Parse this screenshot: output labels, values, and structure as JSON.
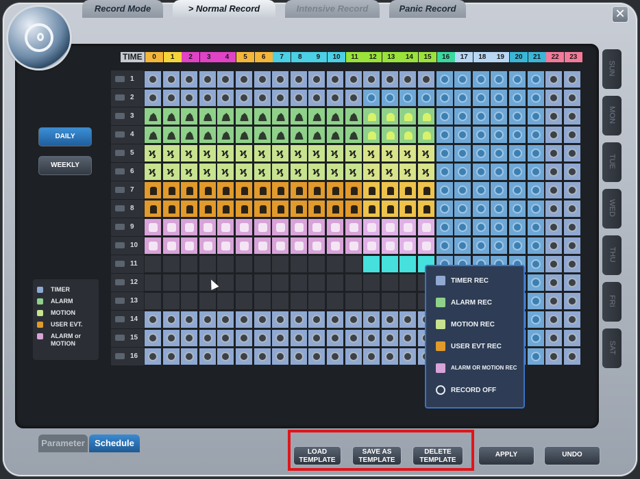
{
  "window": {
    "close_glyph": "✕"
  },
  "tabs": [
    {
      "label": "Record Mode",
      "state": "normal"
    },
    {
      "label": "Normal Record",
      "state": "active",
      "prefix": ">"
    },
    {
      "label": "Intensive Record",
      "state": "disabled"
    },
    {
      "label": "Panic Record",
      "state": "normal"
    }
  ],
  "schedule": {
    "time_label": "TIME",
    "hours": [
      "0",
      "1",
      "2",
      "3",
      "4",
      "5",
      "6",
      "7",
      "8",
      "9",
      "10",
      "11",
      "12",
      "13",
      "14",
      "15",
      "16",
      "17",
      "18",
      "19",
      "20",
      "21",
      "22",
      "23"
    ],
    "hour_colors": [
      "#f4b63a",
      "#f4d63a",
      "#e043c6",
      "#e043c6",
      "#e043c6",
      "#f4b63a",
      "#f4b63a",
      "#4bd0e6",
      "#4bd0e6",
      "#4bd0e6",
      "#4bd0e6",
      "#9ae33a",
      "#9ae33a",
      "#9ae33a",
      "#9ae33a",
      "#9ae33a",
      "#3ad8a0",
      "#b7d7f3",
      "#b7d7f3",
      "#b7d7f3",
      "#3ab7d8",
      "#3ab7d8",
      "#f47a9a",
      "#f47a9a"
    ],
    "channels": [
      "1",
      "2",
      "3",
      "4",
      "5",
      "6",
      "7",
      "8",
      "9",
      "10",
      "11",
      "12",
      "13",
      "14",
      "15",
      "16"
    ],
    "rows": [
      {
        "fill": "timer",
        "split": null
      },
      {
        "fill": "timer",
        "split": {
          "from": 12,
          "to": 15,
          "type": "timer2"
        }
      },
      {
        "fill": "alarm",
        "split": {
          "from": 12,
          "to": 15,
          "type": "alarm2"
        }
      },
      {
        "fill": "alarm",
        "split": {
          "from": 12,
          "to": 15,
          "type": "alarm2"
        }
      },
      {
        "fill": "motion",
        "split": {
          "from": 12,
          "to": 15,
          "type": "motion2"
        }
      },
      {
        "fill": "motion",
        "split": {
          "from": 12,
          "to": 15,
          "type": "motion2"
        }
      },
      {
        "fill": "user",
        "split": {
          "from": 12,
          "to": 15,
          "type": "user2"
        }
      },
      {
        "fill": "user",
        "split": {
          "from": 12,
          "to": 15,
          "type": "user2"
        }
      },
      {
        "fill": "alarmmot",
        "split": {
          "from": 12,
          "to": 15,
          "type": "alarmmot2"
        }
      },
      {
        "fill": "alarmmot",
        "split": {
          "from": 12,
          "to": 15,
          "type": "alarmmot2"
        }
      },
      {
        "fill": "off",
        "split": {
          "from": 12,
          "to": 15,
          "type": "cyan"
        }
      },
      {
        "fill": "off",
        "split": null
      },
      {
        "fill": "off",
        "split": null
      },
      {
        "fill": "timer",
        "split": null
      },
      {
        "fill": "timer",
        "split": null
      },
      {
        "fill": "timer",
        "split": null
      }
    ],
    "tail_from_hour": 16,
    "tail_type": "timer2"
  },
  "days": [
    "SUN",
    "MON",
    "TUE",
    "WED",
    "THU",
    "FRI",
    "SAT"
  ],
  "modes": {
    "daily": "DAILY",
    "weekly": "WEEKLY"
  },
  "legend": [
    {
      "label": "TIMER",
      "color": "#8fa9d3"
    },
    {
      "label": "ALARM",
      "color": "#8fd18a"
    },
    {
      "label": "MOTION",
      "color": "#c8e38f"
    },
    {
      "label": "USER EVT.",
      "color": "#e19a2b"
    },
    {
      "label": "ALARM or",
      "label2": "MOTION",
      "color": "#d8a3d8"
    }
  ],
  "popup": [
    {
      "label": "TIMER REC",
      "color": "#8fa9d3",
      "icon": "timer-icon"
    },
    {
      "label": "ALARM REC",
      "color": "#8fd18a",
      "icon": "alarm-icon"
    },
    {
      "label": "MOTION REC",
      "color": "#c8e38f",
      "icon": "motion-icon"
    },
    {
      "label": "USER EVT REC",
      "color": "#e19a2b",
      "icon": "user-event-icon"
    },
    {
      "label": "ALARM OR MOTION REC",
      "color": "#d8a3d8",
      "icon": "alarm-motion-icon"
    },
    {
      "label": "RECORD  OFF",
      "color": "transparent",
      "icon": "no-record-icon"
    }
  ],
  "bottom_tabs": {
    "parameter": "Parameter",
    "schedule": "Schedule"
  },
  "buttons": {
    "load_1": "LOAD",
    "load_2": "TEMPLATE",
    "save_1": "SAVE AS",
    "save_2": "TEMPLATE",
    "delete_1": "DELETE",
    "delete_2": "TEMPLATE",
    "apply": "APPLY",
    "undo": "UNDO"
  }
}
